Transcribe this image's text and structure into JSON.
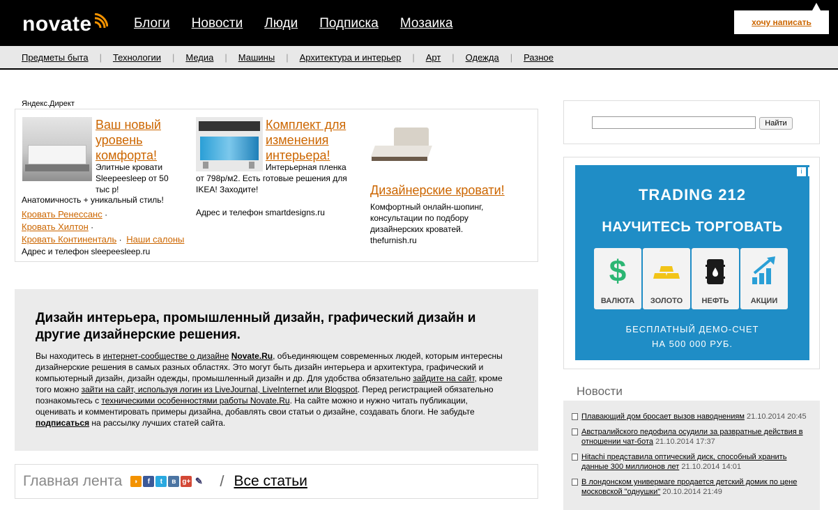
{
  "header": {
    "logo_text": "novate",
    "nav": [
      "Блоги",
      "Новости",
      "Люди",
      "Подписка",
      "Мозаика"
    ],
    "write_label": "хочу написать"
  },
  "subnav": [
    "Предметы быта",
    "Технологии",
    "Медиа",
    "Машины",
    "Архитектура и интерьер",
    "Арт",
    "Одежда",
    "Разное"
  ],
  "yandex": {
    "label": "Яндекс.Директ",
    "ad1": {
      "title": "Ваш новый уровень комфорта!",
      "text1": "Элитные кровати Sleepeesleep от 50 тыс р!",
      "text2": "Анатомичность + уникальный стиль!",
      "links": [
        "Кровать Ренессанс",
        "Кровать Хилтон",
        "Кровать Континенталь",
        "Наши салоны"
      ],
      "domain": "Адрес и телефон  sleepeesleep.ru"
    },
    "ad2": {
      "title": "Комплект для изменения интерьера!",
      "text": "Интерьерная пленка от 798р/м2. Есть готовые решения для IKEA! Заходите!",
      "domain": "Адрес и телефон  smartdesigns.ru"
    },
    "ad3": {
      "title": "Дизайнерские кровати!",
      "text": "Комфортный онлайн-шопинг, консультации по подбору дизайнерских кроватей.",
      "domain": "thefurnish.ru"
    }
  },
  "intro": {
    "heading": "Дизайн интерьера, промышленный дизайн, графический дизайн и другие дизайнерские решения.",
    "p1": "Вы находитесь в ",
    "link1": "интернет-сообществе о дизайне",
    "brand": "Novate.Ru",
    "p2": ", объединяющем современных людей, которым интересны дизайнерские решения в самых разных областях. Это могут быть дизайн интерьера и архитектура, графический и компьютерный дизайн, дизайн одежды, промышленный дизайн и др. Для удобства обязательно ",
    "link2": "зайдите на сайт",
    "p3": ", кроме того можно ",
    "link3": "зайти на сайт, используя логин из LiveJournal, LiveInternet или Blogspot",
    "p4": ". Перед регистрацией обязательно познакомьтесь с ",
    "link4": "техническими особенностями работы Novate.Ru",
    "p5": ". На сайте можно и нужно читать публикации, оценивать и комментировать примеры дизайна, добавлять свои статьи о дизайне, создавать блоги.  Не забудьте ",
    "link5": "подписаться",
    "p6": " на рассылку лучших статей сайта."
  },
  "feed": {
    "title": "Главная лента",
    "separator": "/",
    "all_label": "Все статьи"
  },
  "search": {
    "value": "",
    "button": "Найти"
  },
  "banner": {
    "logo": "TRADING 212",
    "headline": "НАУЧИТЕСЬ ТОРГОВАТЬ",
    "tiles": [
      "ВАЛЮТА",
      "ЗОЛОТО",
      "НЕФТЬ",
      "АКЦИИ"
    ],
    "footer1": "БЕСПЛАТНЫЙ ДЕМО-СЧЕТ",
    "footer2": "НА 500 000 РУБ.",
    "colors": {
      "bg": "#1f8dc6",
      "green": "#2bb673",
      "gold": "#f2c418"
    }
  },
  "news": {
    "title": "Новости",
    "items": [
      {
        "text": "Плавающий дом бросает вызов наводнениям",
        "date": "21.10.2014 20:45"
      },
      {
        "text": "Австралийского педофила осудили за развратные действия в отношении чат-бота",
        "date": "21.10.2014 17:37"
      },
      {
        "text": "Hitachi представила оптический диск, способный хранить данные 300 миллионов лет",
        "date": "21.10.2014 14:01"
      },
      {
        "text": "В лондонском универмаге продается детский домик по цене московской \"однушки\"",
        "date": "20.10.2014 21:49"
      }
    ]
  }
}
